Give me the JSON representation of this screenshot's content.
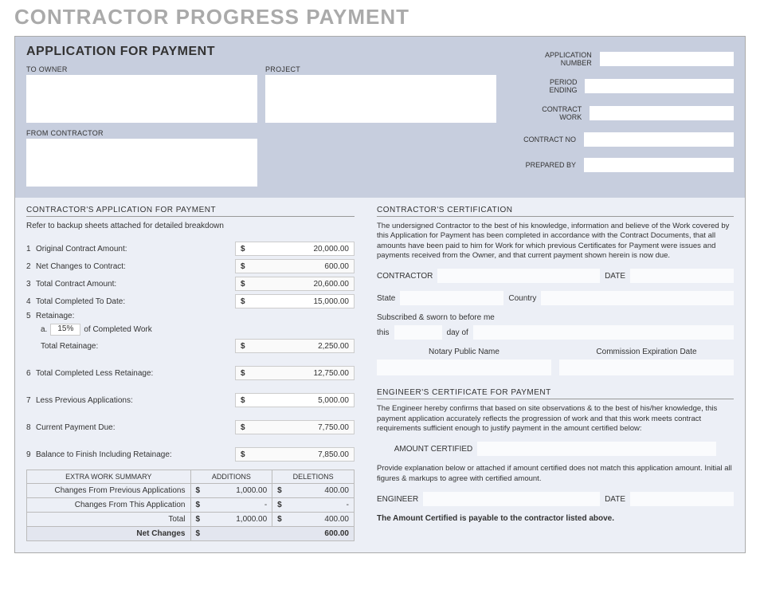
{
  "pageTitle": "CONTRACTOR PROGRESS PAYMENT",
  "applicationHeader": {
    "title": "APPLICATION FOR PAYMENT",
    "toOwnerLabel": "TO OWNER",
    "projectLabel": "PROJECT",
    "fromContractorLabel": "FROM CONTRACTOR",
    "meta": [
      {
        "label": "APPLICATION NUMBER"
      },
      {
        "label": "PERIOD ENDING"
      },
      {
        "label": "CONTRACT WORK"
      },
      {
        "label": "CONTRACT NO"
      },
      {
        "label": "PREPARED BY"
      }
    ]
  },
  "leftSection": {
    "title": "CONTRACTOR'S APPLICATION FOR PAYMENT",
    "note": "Refer to backup sheets attached for detailed breakdown",
    "lines": {
      "l1": {
        "num": "1",
        "label": "Original Contract Amount:",
        "value": "20,000.00",
        "editable": true
      },
      "l2": {
        "num": "2",
        "label": "Net Changes to Contract:",
        "value": "600.00",
        "editable": false
      },
      "l3": {
        "num": "3",
        "label": "Total Contract Amount:",
        "value": "20,600.00",
        "editable": false
      },
      "l4": {
        "num": "4",
        "label": "Total Completed To Date:",
        "value": "15,000.00",
        "editable": true
      },
      "l5": {
        "num": "5",
        "label": "Retainage:"
      },
      "l5a": {
        "letter": "a.",
        "pct": "15%",
        "suffix": "of Completed Work"
      },
      "l5t": {
        "label": "Total Retainage:",
        "value": "2,250.00",
        "editable": false
      },
      "l6": {
        "num": "6",
        "label": "Total Completed Less Retainage:",
        "value": "12,750.00",
        "editable": false
      },
      "l7": {
        "num": "7",
        "label": "Less Previous Applications:",
        "value": "5,000.00",
        "editable": true
      },
      "l8": {
        "num": "8",
        "label": "Current Payment Due:",
        "value": "7,750.00",
        "editable": false
      },
      "l9": {
        "num": "9",
        "label": "Balance to Finish Including Retainage:",
        "value": "7,850.00",
        "editable": false
      }
    },
    "extra": {
      "title": "EXTRA WORK SUMMARY",
      "colAdd": "ADDITIONS",
      "colDel": "DELETIONS",
      "rows": [
        {
          "label": "Changes From Previous Applications",
          "add": "1,000.00",
          "del": "400.00"
        },
        {
          "label": "Changes From This Application",
          "add": "-",
          "del": "-"
        },
        {
          "label": "Total",
          "add": "1,000.00",
          "del": "400.00"
        }
      ],
      "net": {
        "label": "Net Changes",
        "value": "600.00"
      }
    }
  },
  "rightSection": {
    "certTitle": "CONTRACTOR'S CERTIFICATION",
    "certText": "The undersigned Contractor to the best of his knowledge, information and believe of the Work covered by this Application for Payment has been completed in accordance with the Contract Documents, that all amounts have been paid to him for Work for which previous Certificates for Payment were issues and payments received from the Owner, and that current payment shown herein is now due.",
    "contractorLabel": "CONTRACTOR",
    "dateLabel": "DATE",
    "stateLabel": "State",
    "countryLabel": "Country",
    "swornLabel": "Subscribed & sworn to before me",
    "thisLabel": "this",
    "dayOfLabel": "day of",
    "notaryLabel": "Notary Public Name",
    "expirationLabel": "Commission Expiration Date",
    "engTitle": "ENGINEER'S CERTIFICATE FOR PAYMENT",
    "engText": "The Engineer hereby confirms that based on site observations & to the best of his/her knowledge, this payment application accurately reflects the progression of work and that this work meets contract requirements sufficient enough to justify payment in the amount certified below:",
    "amountCertLabel": "AMOUNT CERTIFIED",
    "explainText": "Provide explanation below or attached if amount certified does not match this application amount. Initial all figures & markups to agree with certified amount.",
    "engineerLabel": "ENGINEER",
    "payable": "The Amount Certified is payable to the contractor listed above."
  },
  "currency": "$"
}
